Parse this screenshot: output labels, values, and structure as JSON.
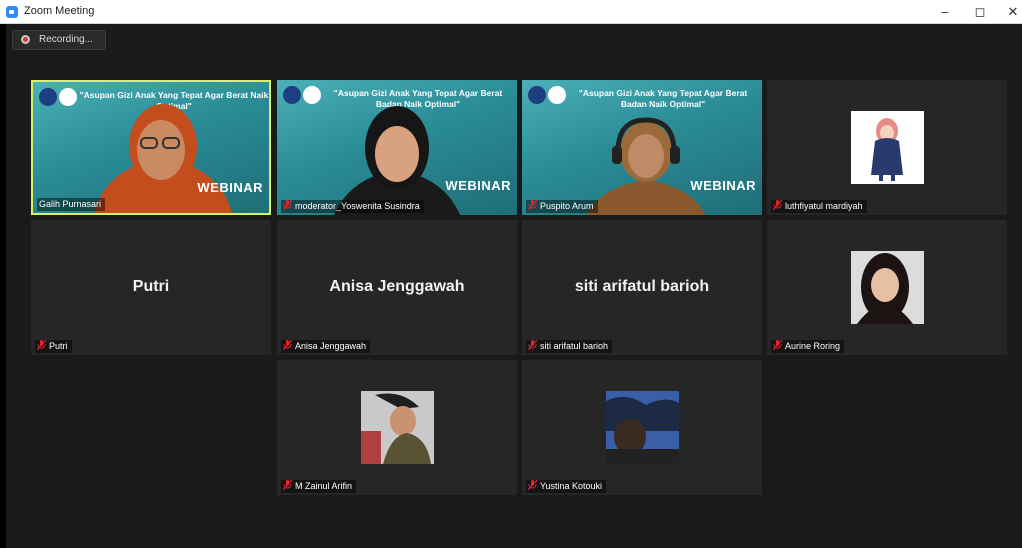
{
  "window": {
    "title": "Zoom Meeting",
    "minimize": "–",
    "restore": "◻",
    "close": "✕"
  },
  "recording": {
    "label": "Recording..."
  },
  "banner": {
    "text_full": "\"Asupan Gizi Anak Yang Tepat Agar Berat Badan Naik Optimal\"",
    "text_partial": "\"Asupan Gizi Anak Yang Tepat Agar Berat Naik Optimal\"",
    "webinar_label": "WEBINAR"
  },
  "participants": [
    {
      "name": "Galih Purnasari",
      "muted": false,
      "active_speaker": true,
      "video": "webinar"
    },
    {
      "name": "moderator_Yoswenita Susindra",
      "muted": true,
      "video": "webinar"
    },
    {
      "name": "Puspito Arum",
      "muted": true,
      "video": "webinar"
    },
    {
      "name": "luthfiyatul mardiyah",
      "muted": true,
      "video": "avatar"
    },
    {
      "name": "Putri",
      "display_name": "Putri",
      "muted": true,
      "video": "off"
    },
    {
      "name": "Anisa Jenggawah",
      "display_name": "Anisa Jenggawah",
      "muted": true,
      "video": "off"
    },
    {
      "name": "siti arifatul barioh",
      "display_name": "siti arifatul barioh",
      "muted": true,
      "video": "off"
    },
    {
      "name": "Aurine Roring",
      "muted": true,
      "video": "avatar"
    },
    {
      "name": "M Zainul Arifin",
      "muted": true,
      "video": "avatar"
    },
    {
      "name": "Yustina Kotouki",
      "muted": true,
      "video": "avatar"
    }
  ],
  "colors": {
    "active_border": "#d7f06a",
    "tile_bg": "#262626",
    "muted_icon": "#e0242f"
  }
}
